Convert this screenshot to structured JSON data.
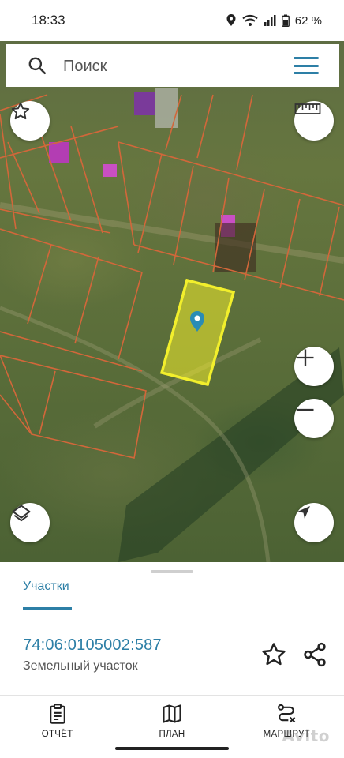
{
  "status_bar": {
    "time": "18:33",
    "battery": "62 %",
    "icons": [
      "location-icon",
      "wifi-icon",
      "signal-icon",
      "battery-icon"
    ]
  },
  "search": {
    "placeholder": "Поиск",
    "value": ""
  },
  "map": {
    "highlight_color": "#f2ef2c",
    "boundary_color": "#d2673a",
    "pin_color": "#2a8cb5"
  },
  "sheet": {
    "tab_label": "Участки",
    "parcel_id": "74:06:0105002:587",
    "parcel_type": "Земельный участок"
  },
  "nav": {
    "report_label": "ОТЧЁТ",
    "plan_label": "ПЛАН",
    "route_label": "МАРШРУТ"
  },
  "watermark": "Avito",
  "colors": {
    "accent": "#2d7fa6",
    "text": "#222222"
  }
}
